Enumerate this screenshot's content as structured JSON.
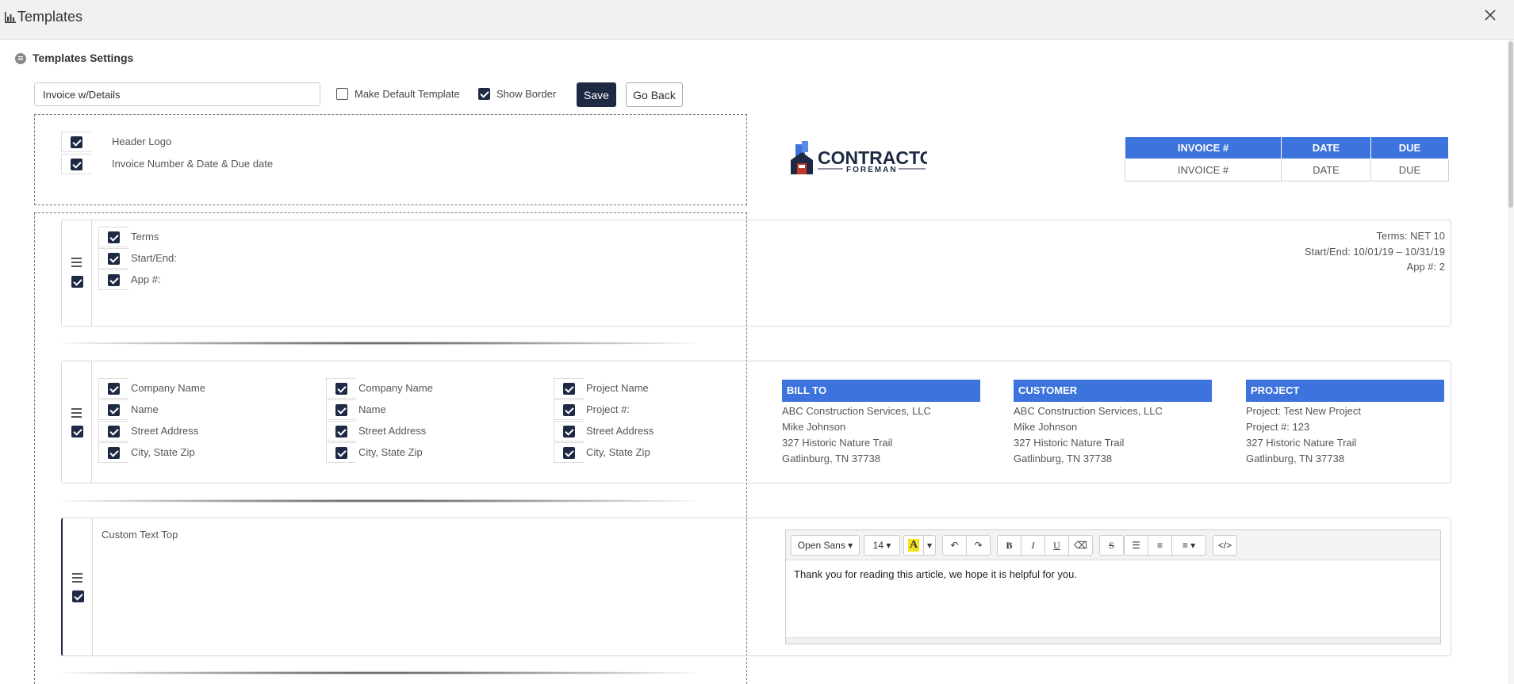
{
  "header": {
    "title": "Templates"
  },
  "settings": {
    "title": "Templates Settings",
    "template_name": "Invoice w/Details",
    "make_default_label": "Make Default Template",
    "make_default_checked": false,
    "show_border_label": "Show Border",
    "show_border_checked": true,
    "save_label": "Save",
    "go_back_label": "Go Back"
  },
  "header_section": {
    "options": [
      {
        "label": "Header Logo",
        "checked": true
      },
      {
        "label": "Invoice Number & Date & Due date",
        "checked": true
      }
    ],
    "logo_text": {
      "main": "CONTRACTOR",
      "sub": "FOREMAN"
    },
    "invoice_table": {
      "headers": [
        "INVOICE #",
        "DATE",
        "DUE"
      ],
      "row": [
        "INVOICE #",
        "DATE",
        "DUE"
      ]
    }
  },
  "terms_section": {
    "options": [
      {
        "label": "Terms",
        "checked": true
      },
      {
        "label": "Start/End:",
        "checked": true
      },
      {
        "label": "App #:",
        "checked": true
      }
    ],
    "preview": [
      "Terms: NET 10",
      "Start/End: 10/01/19 – 10/31/19",
      "App #: 2"
    ]
  },
  "address_section": {
    "columns": [
      [
        "Company Name",
        "Name",
        "Street Address",
        "City, State Zip"
      ],
      [
        "Company Name",
        "Name",
        "Street Address",
        "City, State Zip"
      ],
      [
        "Project Name",
        "Project #:",
        "Street Address",
        "City, State Zip"
      ]
    ],
    "blocks": [
      {
        "title": "BILL TO",
        "lines": [
          "ABC Construction Services, LLC",
          "Mike Johnson",
          "327 Historic Nature Trail",
          "Gatlinburg, TN 37738"
        ]
      },
      {
        "title": "CUSTOMER",
        "lines": [
          "ABC Construction Services, LLC",
          "Mike Johnson",
          "327 Historic Nature Trail",
          "Gatlinburg, TN 37738"
        ]
      },
      {
        "title": "PROJECT",
        "lines": [
          "Project: Test New Project",
          "Project #: 123",
          "327 Historic Nature Trail",
          "Gatlinburg, TN 37738"
        ]
      }
    ]
  },
  "custom_text_section": {
    "label": "Custom Text Top",
    "editor": {
      "font": "Open Sans",
      "size": "14",
      "highlight_color": "#f5e31c",
      "content": "Thank you for reading this article, we hope it is helpful for you."
    }
  },
  "colors": {
    "accent": "#3d73dd",
    "primary": "#1e2a44"
  }
}
